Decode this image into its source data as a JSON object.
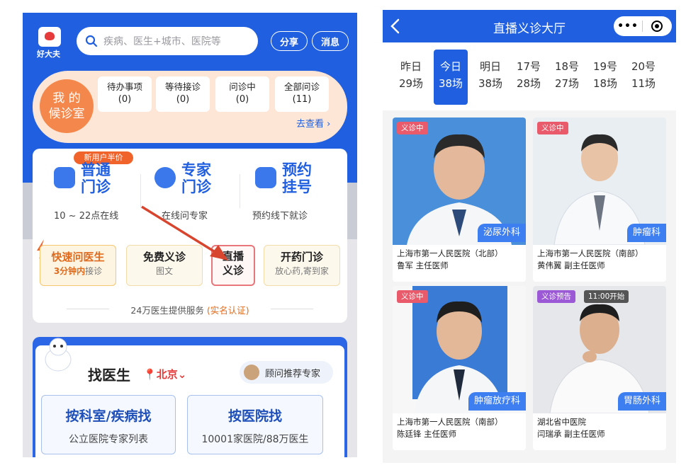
{
  "left": {
    "logo_text": "好大夫",
    "search_placeholder": "疾病、医生+城市、医院等",
    "share_label": "分享",
    "message_label": "消息",
    "waiting_room": {
      "title": "我 的\n候诊室",
      "items": [
        {
          "label": "待办事项",
          "count": "(0)"
        },
        {
          "label": "等待接诊",
          "count": "(0)"
        },
        {
          "label": "问诊中",
          "count": "(0)"
        },
        {
          "label": "全部问诊",
          "count": "(11)"
        }
      ],
      "view_more": "去查看 ›"
    },
    "services": {
      "new_user_tag": "新用户半价",
      "main": [
        {
          "title": "普通\n门诊",
          "subtitle": "10 ~ 22点在线"
        },
        {
          "title": "专家\n门诊",
          "subtitle": "在线问专家"
        },
        {
          "title": "预约\n挂号",
          "subtitle": "预约线下就诊"
        }
      ],
      "quick": [
        {
          "title": "快速问医生",
          "subtitle_bold": "3分钟内",
          "subtitle": "接诊"
        },
        {
          "title": "免费义诊",
          "subtitle": "图文"
        },
        {
          "title": "直播\n义诊",
          "subtitle": ""
        },
        {
          "title": "开药门诊",
          "subtitle": "放心药,寄到家"
        }
      ],
      "summary_prefix": "24万医生提供服务 ",
      "summary_highlight": "(实名认证)"
    },
    "finder": {
      "title": "找医生",
      "city": "北京",
      "advisor_label": "顾问推荐专家",
      "cards": [
        {
          "title": "按科室/疾病找",
          "subtitle": "公立医院专家列表"
        },
        {
          "title": "按医院找",
          "subtitle": "10001家医院/88万医生"
        }
      ]
    }
  },
  "right": {
    "title": "直播义诊大厅",
    "days": [
      {
        "day": "昨日",
        "count": "29场"
      },
      {
        "day": "今日",
        "count": "38场",
        "active": true
      },
      {
        "day": "明日",
        "count": "38场"
      },
      {
        "day": "17号",
        "count": "28场"
      },
      {
        "day": "18号",
        "count": "27场"
      },
      {
        "day": "19号",
        "count": "18场"
      },
      {
        "day": "20号",
        "count": "11场"
      }
    ],
    "doctors": [
      {
        "tag": "义诊中",
        "dept": "泌尿外科",
        "hospital": "上海市第一人民医院（北部）",
        "name": "鲁军 主任医师"
      },
      {
        "tag": "义诊中",
        "dept": "肿瘤科",
        "hospital": "上海市第一人民医院（南部）",
        "name": "黄伟翼 副主任医师"
      },
      {
        "tag": "义诊中",
        "dept": "肿瘤放疗科",
        "hospital": "上海市第一人民医院（南部）",
        "name": "陈廷锋 主任医师"
      },
      {
        "tag": "义诊预告",
        "tag2": "11:00开始",
        "dept": "胃肠外科",
        "hospital": "湖北省中医院",
        "name": "闫瑞承 副主任医师"
      }
    ]
  },
  "colors": {
    "brand_blue": "#1f5fe0",
    "orange": "#f4884c",
    "highlight_red": "#e9767a",
    "live_tag": "#e95a6b"
  }
}
